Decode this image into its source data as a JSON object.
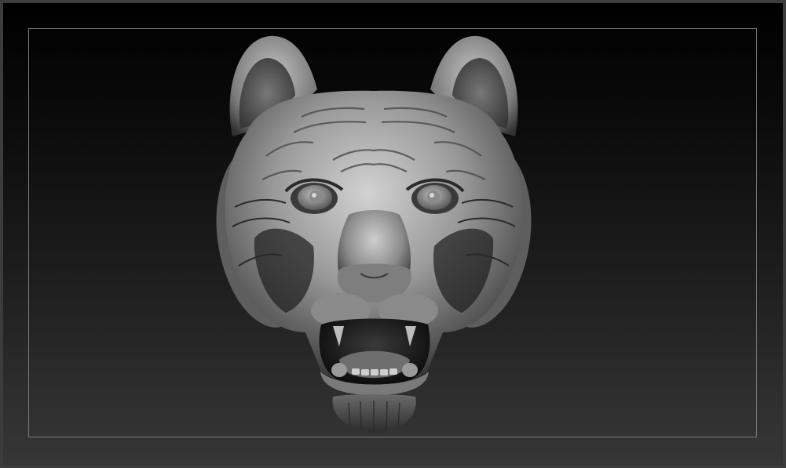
{
  "viewport": {
    "model_icon": "tiger-head-sculpt-icon",
    "colors": {
      "background_top": "#000000",
      "background_bottom": "#363636",
      "frame_border": "#7a7a7a",
      "window_border": "#3c3c3c",
      "clay_highlight": "#d2d2d2",
      "clay_mid": "#8c8c8c",
      "clay_shadow": "#1e1e1e"
    }
  }
}
